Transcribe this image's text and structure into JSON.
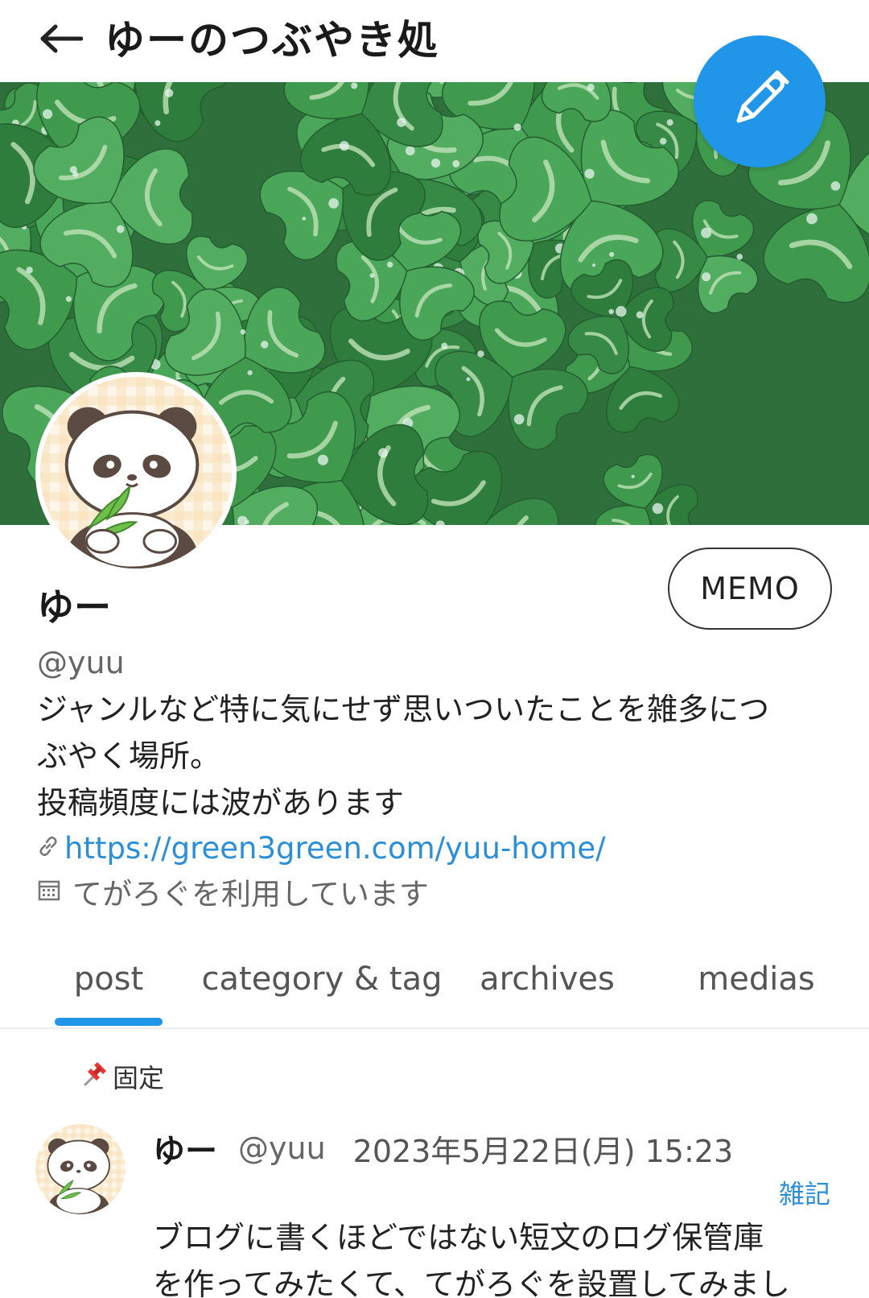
{
  "header": {
    "title": "ゆーのつぶやき処",
    "back_icon": "back-arrow-icon",
    "compose_icon": "pen-icon"
  },
  "profile": {
    "display_name": "ゆー",
    "handle": "@yuu",
    "memo_label": "MEMO",
    "bio_lines": [
      "ジャンルなど特に気にせず思いついたことを雑多につ",
      "ぶやく場所。",
      "投稿頻度には波があります"
    ],
    "link_url": "https://green3green.com/yuu-home/",
    "using_text": "てがろぐを利用しています"
  },
  "tabs": [
    {
      "label": "post",
      "active": true
    },
    {
      "label": "category & tag",
      "active": false
    },
    {
      "label": "archives",
      "active": false
    },
    {
      "label": "medias",
      "active": false
    }
  ],
  "pinned_label": "固定",
  "post": {
    "name": "ゆー",
    "handle": "@yuu",
    "date": "2023年5月22日(月) 15:23",
    "category": "雑記",
    "body_lines": [
      "ブログに書くほどではない短文のログ保管庫",
      "を作ってみたくて、てがろぐを設置してみまし"
    ]
  },
  "colors": {
    "accent": "#2196e8",
    "link": "#2a8fd8",
    "clover": "#3f9a4e"
  }
}
